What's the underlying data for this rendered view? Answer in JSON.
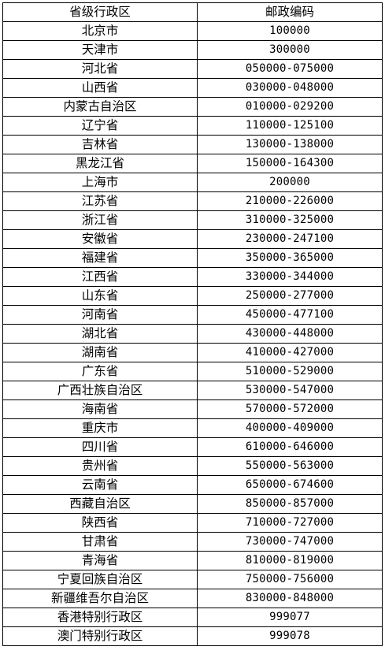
{
  "table": {
    "headers": [
      "省级行政区",
      "邮政编码"
    ],
    "rows": [
      {
        "region": "北京市",
        "code": "100000"
      },
      {
        "region": "天津市",
        "code": "300000"
      },
      {
        "region": "河北省",
        "code": "050000-075000"
      },
      {
        "region": "山西省",
        "code": "030000-048000"
      },
      {
        "region": "内蒙古自治区",
        "code": "010000-029200"
      },
      {
        "region": "辽宁省",
        "code": "110000-125100"
      },
      {
        "region": "吉林省",
        "code": "130000-138000"
      },
      {
        "region": "黑龙江省",
        "code": "150000-164300"
      },
      {
        "region": "上海市",
        "code": "200000"
      },
      {
        "region": "江苏省",
        "code": "210000-226000"
      },
      {
        "region": "浙江省",
        "code": "310000-325000"
      },
      {
        "region": "安徽省",
        "code": "230000-247100"
      },
      {
        "region": "福建省",
        "code": "350000-365000"
      },
      {
        "region": "江西省",
        "code": "330000-344000"
      },
      {
        "region": "山东省",
        "code": "250000-277000"
      },
      {
        "region": "河南省",
        "code": "450000-477100"
      },
      {
        "region": "湖北省",
        "code": "430000-448000"
      },
      {
        "region": "湖南省",
        "code": "410000-427000"
      },
      {
        "region": "广东省",
        "code": "510000-529000"
      },
      {
        "region": "广西壮族自治区",
        "code": "530000-547000"
      },
      {
        "region": "海南省",
        "code": "570000-572000"
      },
      {
        "region": "重庆市",
        "code": "400000-409000"
      },
      {
        "region": "四川省",
        "code": "610000-646000"
      },
      {
        "region": "贵州省",
        "code": "550000-563000"
      },
      {
        "region": "云南省",
        "code": "650000-674600"
      },
      {
        "region": "西藏自治区",
        "code": "850000-857000"
      },
      {
        "region": "陕西省",
        "code": "710000-727000"
      },
      {
        "region": "甘肃省",
        "code": "730000-747000"
      },
      {
        "region": "青海省",
        "code": "810000-819000"
      },
      {
        "region": "宁夏回族自治区",
        "code": "750000-756000"
      },
      {
        "region": "新疆维吾尔自治区",
        "code": "830000-848000"
      },
      {
        "region": "香港特别行政区",
        "code": "999077"
      },
      {
        "region": "澳门特别行政区",
        "code": "999078"
      }
    ]
  }
}
